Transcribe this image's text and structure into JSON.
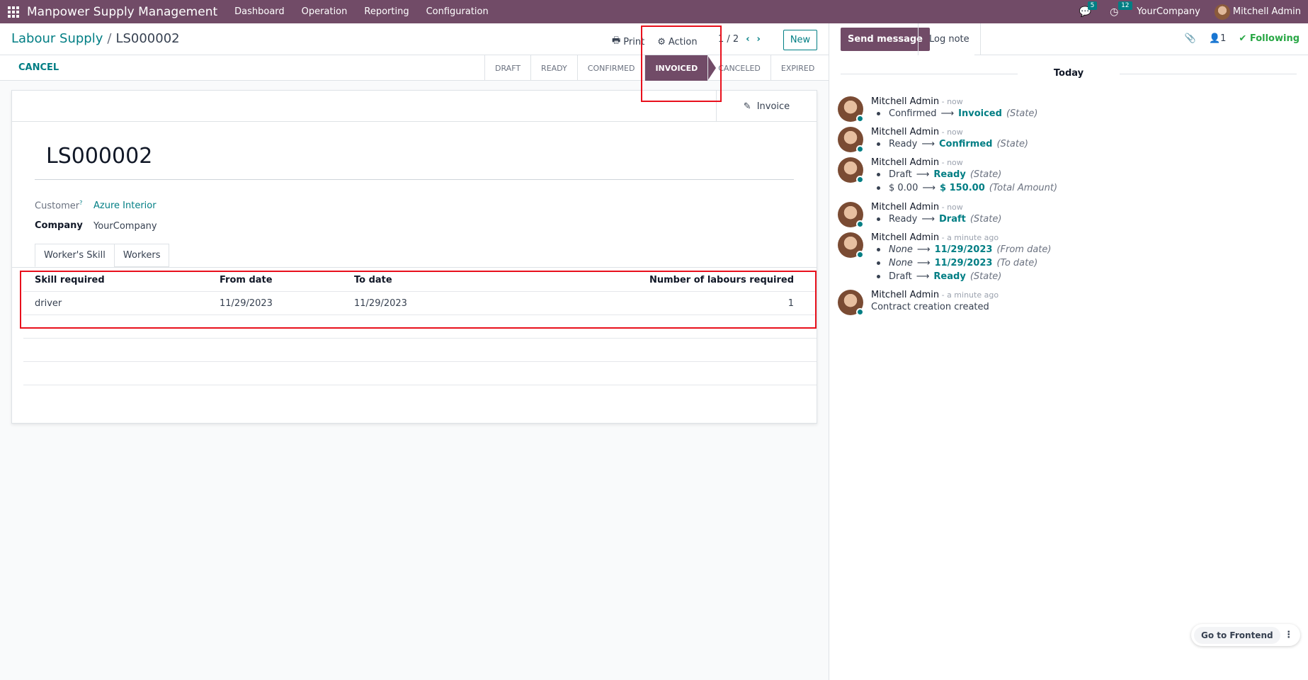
{
  "navbar": {
    "app_title": "Manpower Supply Management",
    "menu": [
      "Dashboard",
      "Operation",
      "Reporting",
      "Configuration"
    ],
    "messages_count": "5",
    "activities_count": "12",
    "company": "YourCompany",
    "user": "Mitchell Admin"
  },
  "breadcrumb": {
    "parent": "Labour Supply",
    "separator": "/",
    "current": "LS000002"
  },
  "control_panel": {
    "print": "Print",
    "action": "Action",
    "pager": "1 / 2",
    "new": "New"
  },
  "status_bar": {
    "cancel": "CANCEL",
    "stages": [
      "DRAFT",
      "READY",
      "CONFIRMED",
      "INVOICED",
      "CANCELED",
      "EXPIRED"
    ],
    "active_stage": "INVOICED"
  },
  "form": {
    "invoice_button": "Invoice",
    "name": "LS000002",
    "customer_label": "Customer",
    "customer_help": "?",
    "customer_value": "Azure Interior",
    "company_label": "Company",
    "company_value": "YourCompany",
    "tabs": [
      "Worker's Skill",
      "Workers"
    ],
    "table": {
      "headers": [
        "Skill required",
        "From date",
        "To date",
        "Number of labours required"
      ],
      "rows": [
        [
          "driver",
          "11/29/2023",
          "11/29/2023",
          "1"
        ]
      ]
    }
  },
  "chatter": {
    "send_message": "Send message",
    "log_note": "Log note",
    "followers_count": "1",
    "following": "Following",
    "today": "Today",
    "messages": [
      {
        "author": "Mitchell Admin",
        "time": "- now",
        "lines": [
          {
            "old": "Confirmed",
            "new": "Invoiced",
            "field": "(State)"
          }
        ]
      },
      {
        "author": "Mitchell Admin",
        "time": "- now",
        "lines": [
          {
            "old": "Ready",
            "new": "Confirmed",
            "field": "(State)"
          }
        ]
      },
      {
        "author": "Mitchell Admin",
        "time": "- now",
        "lines": [
          {
            "old": "Draft",
            "new": "Ready",
            "field": "(State)"
          },
          {
            "old": "$ 0.00",
            "new": "$ 150.00",
            "field": "(Total Amount)"
          }
        ]
      },
      {
        "author": "Mitchell Admin",
        "time": "- now",
        "lines": [
          {
            "old": "Ready",
            "new": "Draft",
            "field": "(State)"
          }
        ]
      },
      {
        "author": "Mitchell Admin",
        "time": "- a minute ago",
        "lines": [
          {
            "old": "None",
            "new": "11/29/2023",
            "field": "(From date)"
          },
          {
            "old": "None",
            "new": "11/29/2023",
            "field": "(To date)"
          },
          {
            "old": "Draft",
            "new": "Ready",
            "field": "(State)"
          }
        ]
      },
      {
        "author": "Mitchell Admin",
        "time": "- a minute ago",
        "body": "Contract creation created"
      }
    ],
    "arrow": "⟶"
  },
  "frontend": {
    "label": "Go to Frontend",
    "more": "⋮"
  },
  "colors": {
    "brand": "#714b67",
    "link": "#017e84",
    "highlight": "#e8101c"
  }
}
